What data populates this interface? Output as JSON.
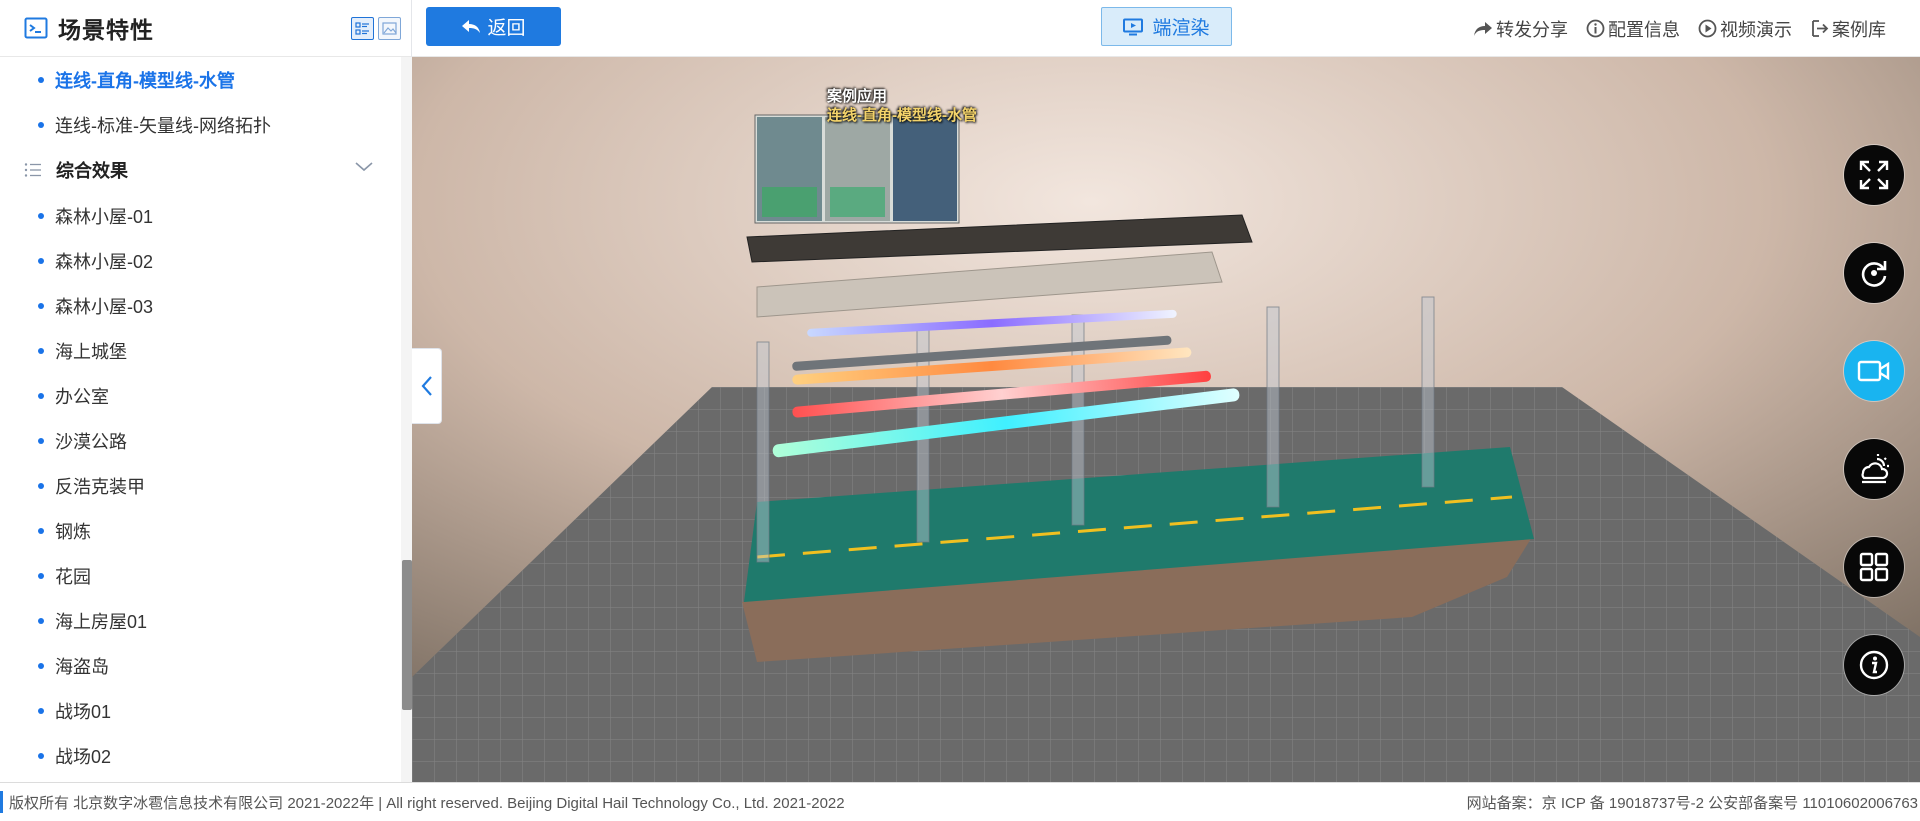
{
  "sidebar": {
    "title": "场景特性",
    "top_items": [
      {
        "label": "连线-直角-模型线-水管",
        "active": true
      },
      {
        "label": "连线-标准-矢量线-网络拓扑",
        "active": false
      }
    ],
    "group": {
      "label": "综合效果"
    },
    "group_items": [
      "森林小屋-01",
      "森林小屋-02",
      "森林小屋-03",
      "海上城堡",
      "办公室",
      "沙漠公路",
      "反浩克装甲",
      "钢炼",
      "花园",
      "海上房屋01",
      "海盗岛",
      "战场01",
      "战场02"
    ]
  },
  "topbar": {
    "back_label": "返回",
    "render_label": "端渲染",
    "actions": {
      "share": "转发分享",
      "config": "配置信息",
      "video": "视频演示",
      "cases": "案例库"
    }
  },
  "scene": {
    "caption_line1": "案例应用",
    "caption_line2": "连线-直角-模型线-水管"
  },
  "tools": [
    "fullscreen-icon",
    "rotate-icon",
    "video-camera-icon",
    "weather-icon",
    "grid-icon",
    "info-icon"
  ],
  "footer": {
    "copyright": "版权所有 北京数字冰雹信息技术有限公司 2021-2022年 | All right reserved. Beijing Digital Hail Technology Co., Ltd. 2021-2022",
    "icp": "网站备案：京 ICP 备 19018737号-2 公安部备案号 11010602006763"
  },
  "colors": {
    "accent": "#1f7ae0",
    "active_tool": "#19b4f0",
    "grid_floor": "#5e5e5e"
  }
}
